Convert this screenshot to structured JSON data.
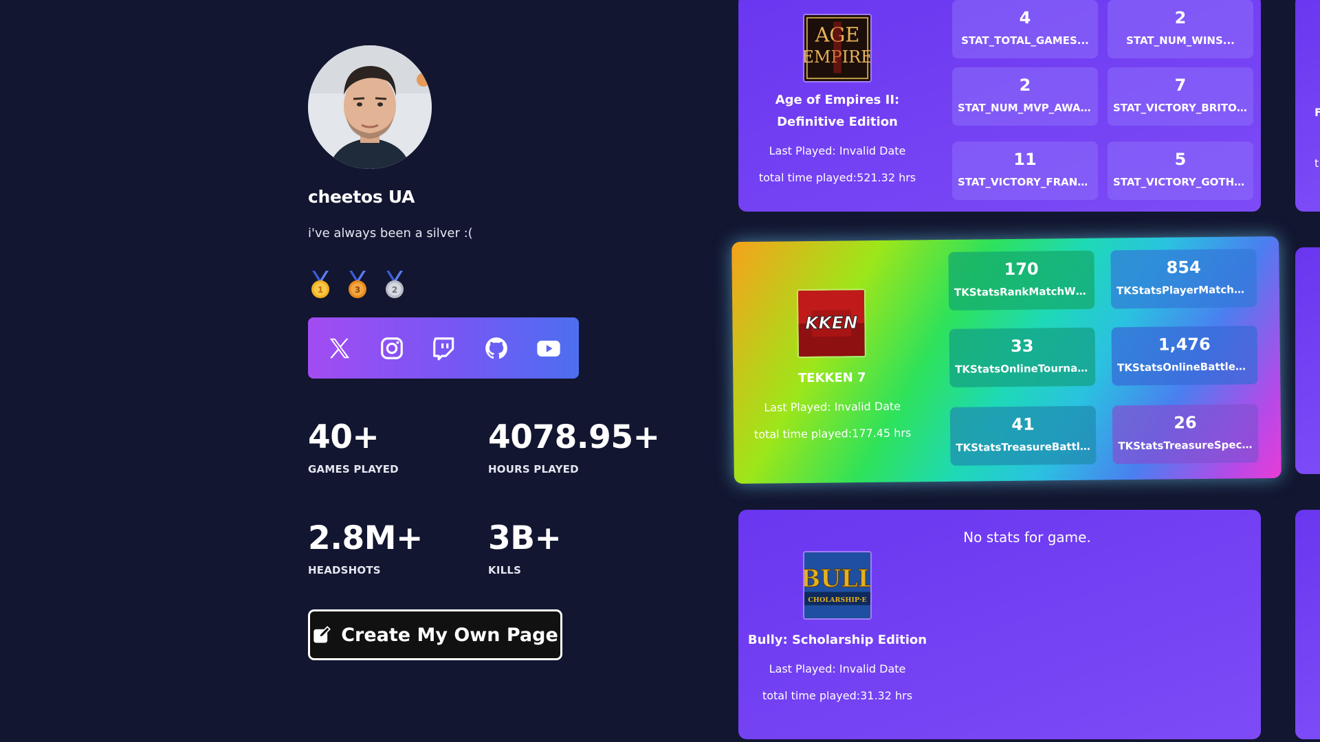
{
  "profile": {
    "username": "cheetos UA",
    "bio": "i've always been a silver :(",
    "medals": [
      {
        "icon": "gold-medal-icon",
        "rank": "1",
        "color": "#f3b21c"
      },
      {
        "icon": "bronze-medal-icon",
        "rank": "3",
        "color": "#e88a1c"
      },
      {
        "icon": "silver-medal-icon",
        "rank": "2",
        "color": "#c8ccd4"
      }
    ],
    "socials": [
      "x-icon",
      "instagram-icon",
      "twitch-icon",
      "github-icon",
      "youtube-icon"
    ],
    "stats": [
      {
        "value": "40+",
        "label": "GAMES PLAYED"
      },
      {
        "value": "4078.95+",
        "label": "HOURS PLAYED"
      },
      {
        "value": "2.8M+",
        "label": "HEADSHOTS"
      },
      {
        "value": "3B+",
        "label": "KILLS"
      }
    ],
    "create_button": "Create My Own Page"
  },
  "games": [
    {
      "title": "Age of Empires II: Definitive Edition",
      "last_played": "Last Played: Invalid Date",
      "total_time": "total time played:521.32 hrs",
      "logo_text_1": "AGE",
      "logo_text_2": "EMPIRE",
      "stats": [
        {
          "value": "4",
          "label": "STAT_TOTAL_GAMES..."
        },
        {
          "value": "2",
          "label": "STAT_NUM_WINS..."
        },
        {
          "value": "2",
          "label": "STAT_NUM_MVP_AWARDS..."
        },
        {
          "value": "7",
          "label": "STAT_VICTORY_BRITONS..."
        },
        {
          "value": "11",
          "label": "STAT_VICTORY_FRANKS..."
        },
        {
          "value": "5",
          "label": "STAT_VICTORY_GOTHS..."
        }
      ]
    },
    {
      "title": "TEKKEN 7",
      "last_played": "Last Played: Invalid Date",
      "total_time": "total time played:177.45 hrs",
      "logo_text": "KKEN",
      "stats": [
        {
          "value": "170",
          "label": "TKStatsRankMatchWin..."
        },
        {
          "value": "854",
          "label": "TKStatsPlayerMatchWi..."
        },
        {
          "value": "33",
          "label": "TKStatsOnlineTournam..."
        },
        {
          "value": "1,476",
          "label": "TKStatsOnlineBattled..."
        },
        {
          "value": "41",
          "label": "TKStatsTreasureBattl..."
        },
        {
          "value": "26",
          "label": "TKStatsTreasureSpeci..."
        }
      ]
    },
    {
      "title": "Bully: Scholarship Edition",
      "last_played": "Last Played: Invalid Date",
      "total_time": "total time played:31.32 hrs",
      "no_stats": "No stats for game.",
      "logo_text_1": "BULL",
      "logo_text_2": "CHOLARSHIP·E"
    }
  ],
  "edge_cards": [
    {
      "glyph": "F"
    },
    {
      "glyph": "t"
    }
  ],
  "colors": {
    "background": "#121630",
    "card_purple": "#6a36f0",
    "social_gradient_start": "#a24cf2",
    "social_gradient_end": "#4d6ff0"
  }
}
